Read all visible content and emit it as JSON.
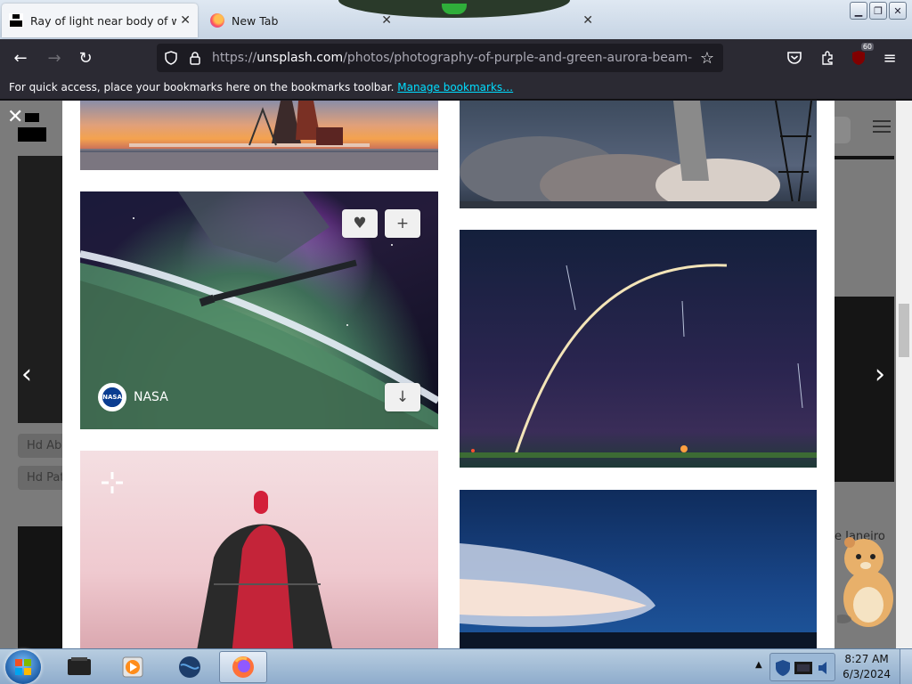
{
  "browser": {
    "tabs": [
      {
        "title": "Ray of light near body of water",
        "active": true,
        "favicon": "unsplash-favicon"
      },
      {
        "title": "New Tab",
        "active": false,
        "favicon": "firefox-favicon"
      }
    ],
    "url": {
      "prefix": "https://",
      "host": "unsplash.com",
      "path": "/photos/photography-of-purple-and-green-aurora-beam-below-gr"
    },
    "bookmarks_bar": {
      "message": "For quick access, place your bookmarks here on the bookmarks toolbar.",
      "link": "Manage bookmarks…"
    },
    "extension_badge": "60"
  },
  "modal": {
    "featured_photo": {
      "author": "NASA",
      "avatar_text": "NASA",
      "alt": "Ray of light near body of water"
    },
    "background_chips": [
      "Hd Ab",
      "Hd Pat"
    ],
    "background_caption": "e Janeiro"
  },
  "taskbar": {
    "time": "8:27 AM",
    "date": "6/3/2024",
    "items": [
      "media-center-icon",
      "media-player-icon",
      "globe-icon",
      "firefox-icon"
    ]
  },
  "colors": {
    "accent_link": "#00ddff",
    "chrome_dark": "#2b2a33",
    "modal_bg": "#ffffff"
  }
}
